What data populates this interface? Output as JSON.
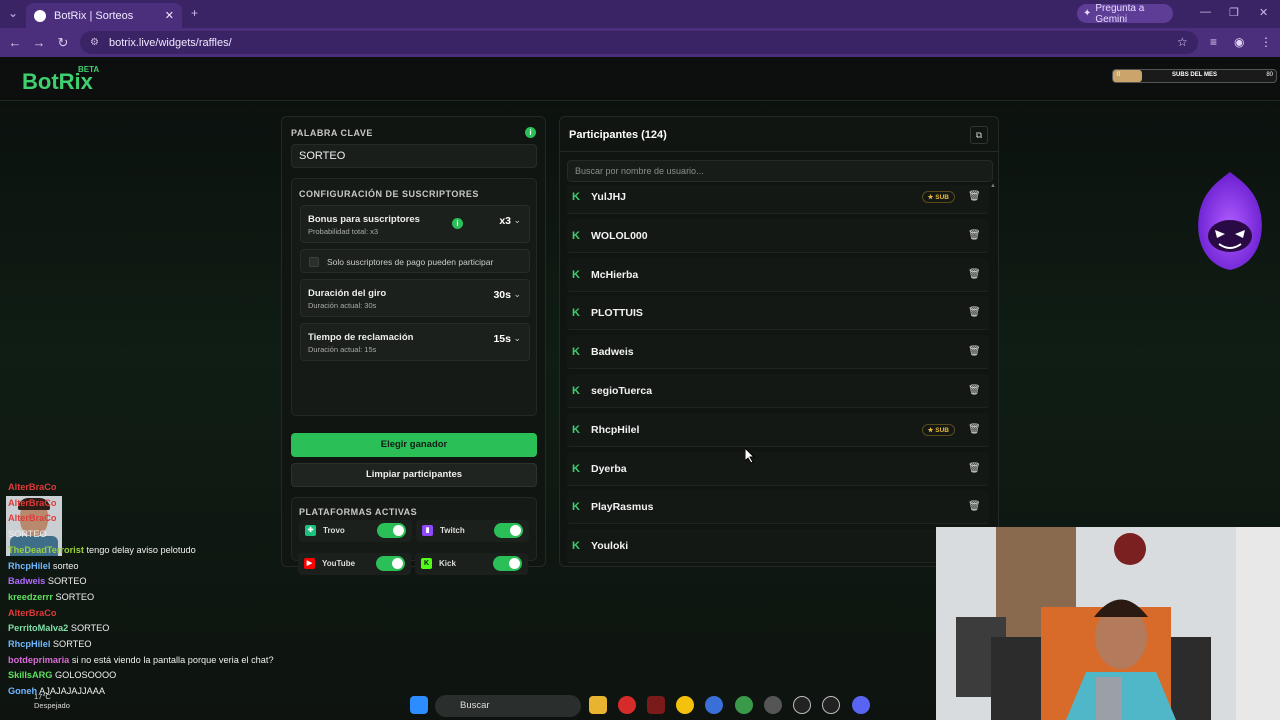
{
  "browser": {
    "tab_title": "BotRix | Sorteos",
    "new_tab": "+",
    "gemini_button": "Pregunta a Gemini",
    "url": "botrix.live/widgets/raffles/"
  },
  "site": {
    "logo": "BotRix",
    "logo_badge": "BETA",
    "subs_bar": {
      "label": "SUBS DEL MES",
      "current": "0",
      "goal": "80",
      "progress": 0.18
    }
  },
  "settings": {
    "keyword_label": "PALABRA CLAVE",
    "keyword_value": "SORTEO",
    "subs_config_label": "CONFIGURACIÓN DE SUSCRIPTORES",
    "bonus_title": "Bonus para suscriptores",
    "bonus_sub": "Probabilidad total: x3",
    "bonus_value": "x3",
    "paid_only_label": "Solo suscriptores de pago pueden participar",
    "spin_title": "Duración del giro",
    "spin_sub": "Duración actual: 30s",
    "spin_value": "30s",
    "claim_title": "Tiempo de reclamación",
    "claim_sub": "Duración actual: 15s",
    "claim_value": "15s",
    "pick_winner_button": "Elegir ganador",
    "clear_button": "Limpiar participantes",
    "platforms_label": "PLATAFORMAS ACTIVAS",
    "platforms": [
      {
        "name": "Trovo",
        "color": "#19c37d",
        "enabled": true
      },
      {
        "name": "Twitch",
        "color": "#9146ff",
        "enabled": true
      },
      {
        "name": "YouTube",
        "color": "#ff0000",
        "enabled": true
      },
      {
        "name": "Kick",
        "color": "#53fc18",
        "enabled": true
      }
    ]
  },
  "participants": {
    "title": "Participantes (124)",
    "search_placeholder": "Buscar por nombre de usuario...",
    "sub_badge": "SUB",
    "list": [
      {
        "name": "YulJHJ",
        "sub": true
      },
      {
        "name": "WOLOL000",
        "sub": false
      },
      {
        "name": "McHierba",
        "sub": false
      },
      {
        "name": "PLOTTUIS",
        "sub": false
      },
      {
        "name": "Badweis",
        "sub": false
      },
      {
        "name": "segioTuerca",
        "sub": false
      },
      {
        "name": "RhcpHilel",
        "sub": true
      },
      {
        "name": "Dyerba",
        "sub": false
      },
      {
        "name": "PlayRasmus",
        "sub": false
      },
      {
        "name": "Youloki",
        "sub": false
      }
    ]
  },
  "chat": [
    {
      "user": "AlterBraCo",
      "msg": "",
      "color": "#e03a3a"
    },
    {
      "user": "AlterBraCo",
      "msg": "",
      "color": "#e03a3a"
    },
    {
      "user": "AlterBraCo",
      "msg": "",
      "color": "#e03a3a"
    },
    {
      "user": "",
      "msg": "SORTEO",
      "color": "#e03a3a"
    },
    {
      "user": "TheDeadTerrorist",
      "msg": "tengo delay aviso pelotudo",
      "color": "#9bd13a"
    },
    {
      "user": "RhcpHilel",
      "msg": "sorteo",
      "color": "#6fb8ff"
    },
    {
      "user": "Badweis",
      "msg": "SORTEO",
      "color": "#b06bff"
    },
    {
      "user": "kreedzerrr",
      "msg": "SORTEO",
      "color": "#5fe05f"
    },
    {
      "user": "AlterBraCo",
      "msg": "",
      "color": "#e03a3a"
    },
    {
      "user": "PerritoMalva2",
      "msg": "SORTEO",
      "color": "#7ee0a8"
    },
    {
      "user": "RhcpHilel",
      "msg": "SORTEO",
      "color": "#6fb8ff"
    },
    {
      "user": "botdeprimaria",
      "msg": "si no está viendo la pantalla porque veria el chat?",
      "color": "#d86bd8"
    },
    {
      "user": "SkillsARG",
      "msg": "GOLOSOOOO",
      "color": "#5fe05f"
    },
    {
      "user": "Goneh",
      "msg": "AJAJAJAJJAAA",
      "color": "#6fb8ff"
    }
  ],
  "taskbar": {
    "search_placeholder": "Buscar",
    "weather_temp": "17°C",
    "weather_text": "Despejado"
  }
}
